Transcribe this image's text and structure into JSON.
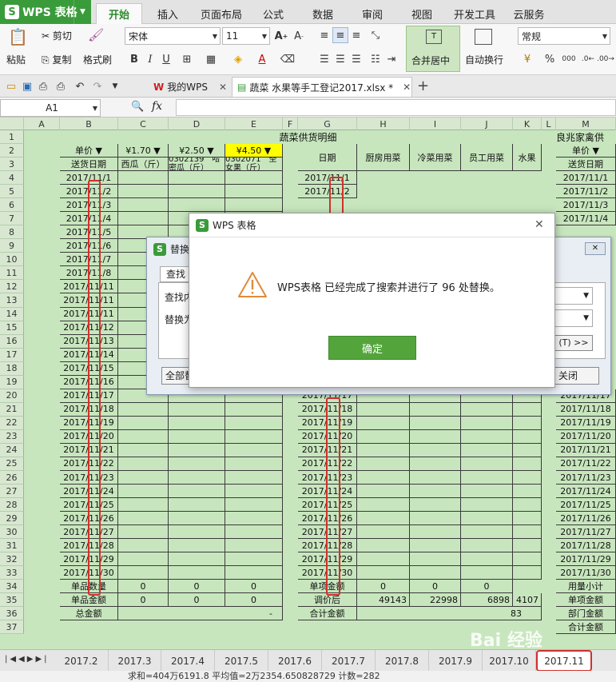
{
  "app": {
    "name": "WPS 表格"
  },
  "menu": [
    "开始",
    "插入",
    "页面布局",
    "公式",
    "数据",
    "审阅",
    "视图",
    "开发工具",
    "云服务"
  ],
  "ribbon": {
    "paste": "粘贴",
    "cut": "剪切",
    "copy": "复制",
    "format_painter": "格式刷",
    "font": "宋体",
    "size": "11",
    "bold": "B",
    "italic": "I",
    "underline": "U",
    "merge": "合并居中",
    "wrap": "自动换行",
    "number_format": "常规",
    "percent": "%",
    "comma": "000"
  },
  "doctabs": {
    "mywps": "我的WPS",
    "file": "蔬菜 水果等手工登记2017.xlsx *",
    "add": "+"
  },
  "namebox": "A1",
  "fx": "fx",
  "columns": [
    "A",
    "B",
    "C",
    "D",
    "E",
    "F",
    "G",
    "H",
    "I",
    "J",
    "K",
    "L",
    "M"
  ],
  "rows": [
    "1",
    "2",
    "3",
    "4",
    "5",
    "6",
    "7",
    "8",
    "9",
    "10",
    "11",
    "12",
    "13",
    "14",
    "15",
    "16",
    "17",
    "18",
    "19",
    "20",
    "21",
    "22",
    "23",
    "24",
    "25",
    "26",
    "27",
    "28",
    "29",
    "30",
    "31",
    "32",
    "33",
    "34",
    "35",
    "36",
    "37"
  ],
  "table": {
    "title1": "蔬菜供货明细",
    "title2": "良兆家禽供",
    "unit_price": "单价",
    "price_c": "¥1.70",
    "price_d": "¥2.50",
    "price_e": "¥4.50",
    "send_date": "送货日期",
    "watermelon": "西瓜（斤）",
    "melon": "0302139　哈密瓜（斤）",
    "orange": "0302071　圣女果（斤）",
    "date": "日期",
    "kitchen": "厨房用菜",
    "cold": "冷菜用菜",
    "staff": "员工用菜",
    "fruit": "水果",
    "m_unit": "单价",
    "m_send": "送货日期",
    "b_dates": [
      "2017/11/1",
      "2017/11/2",
      "2017/11/3",
      "2017/11/4",
      "2017/11/5",
      "2017/11/6",
      "2017/11/7",
      "2017/11/8",
      "2017/11/11",
      "2017/11/11",
      "2017/11/11",
      "2017/11/12",
      "2017/11/13",
      "2017/11/14",
      "2017/11/15",
      "2017/11/16",
      "2017/11/17",
      "2017/11/18",
      "2017/11/19",
      "2017/11/20",
      "2017/11/21",
      "2017/11/22",
      "2017/11/23",
      "2017/11/24",
      "2017/11/25",
      "2017/11/26",
      "2017/11/27",
      "2017/11/28",
      "2017/11/29",
      "2017/11/30"
    ],
    "g_dates_top": [
      "2017/11/1",
      "2017/11/2"
    ],
    "g_dates": [
      "2017/11/17",
      "2017/11/18",
      "2017/11/19",
      "2017/11/20",
      "2017/11/21",
      "2017/11/22",
      "2017/11/23",
      "2017/11/24",
      "2017/11/25",
      "2017/11/26",
      "2017/11/27",
      "2017/11/28",
      "2017/11/29",
      "2017/11/30"
    ],
    "m_dates": [
      "2017/11/1",
      "2017/11/2",
      "2017/11/3",
      "2017/11/4"
    ],
    "m_dates_bottom": [
      "2017/11/17",
      "2017/11/18",
      "2017/11/19",
      "2017/11/20",
      "2017/11/21",
      "2017/11/22",
      "2017/11/23",
      "2017/11/24",
      "2017/11/25",
      "2017/11/26",
      "2017/11/27",
      "2017/11/28",
      "2017/11/29",
      "2017/11/30"
    ],
    "qty_label": "单品数量",
    "amt_label": "单品金额",
    "total_label": "总金额",
    "qty_vals": [
      "0",
      "0",
      "0"
    ],
    "amt_vals": [
      "0",
      "0",
      "0"
    ],
    "total_val": "-",
    "item_amt": "单项金额",
    "adjusted": "调价后",
    "sum_amt": "合计金额",
    "item_vals": [
      "0",
      "0",
      "0"
    ],
    "adj_vals": [
      "49143",
      "22998",
      "6898",
      "4107"
    ],
    "sum_val": "83",
    "m34": "用量小计",
    "m35": "单项金额",
    "m36": "部门金额",
    "m37": "合计金额"
  },
  "replace_dialog": {
    "title": "替换",
    "tab": "查找",
    "find_label": "查找内",
    "replace_label": "替换为",
    "replace_all": "全部替",
    "options": "(T) >>",
    "close": "关闭"
  },
  "msgbox": {
    "title": "WPS 表格",
    "message": "WPS表格 已经完成了搜索并进行了 96 处替换。",
    "ok": "确定"
  },
  "sheet_tabs": [
    "2017.2",
    "2017.3",
    "2017.4",
    "2017.5",
    "2017.6",
    "2017.7",
    "2017.8",
    "2017.9",
    "2017.10",
    "2017.11"
  ],
  "status": "求和=404万6191.8  平均值=2万2354.650828729  计数=282",
  "watermark": "Bai 经验"
}
